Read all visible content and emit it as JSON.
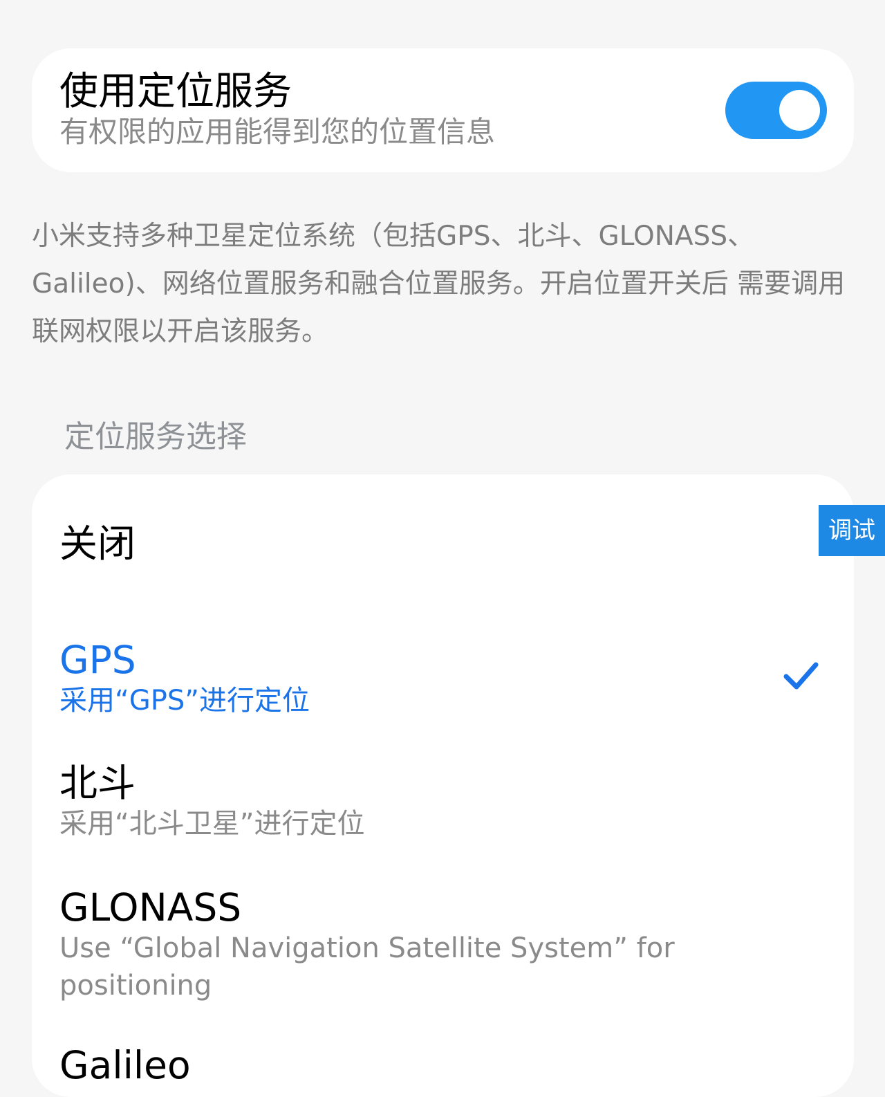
{
  "location_toggle": {
    "title": "使用定位服务",
    "subtitle": "有权限的应用能得到您的位置信息",
    "enabled": true,
    "accent_color": "#2196f3"
  },
  "description": "小米支持多种卫星定位系统（包括GPS、北斗、GLONASS、Galileo)、网络位置服务和融合位置服务。开启位置开关后 需要调用联网权限以开启该服务。",
  "section_header": "定位服务选择",
  "options": [
    {
      "title": "关闭",
      "subtitle": "",
      "selected": false
    },
    {
      "title": "GPS",
      "subtitle": "采用“GPS”进行定位",
      "selected": true
    },
    {
      "title": "北斗",
      "subtitle": "采用“北斗卫星”进行定位",
      "selected": false
    },
    {
      "title": "GLONASS",
      "subtitle": "Use “Global Navigation Satellite System” for positioning",
      "selected": false
    },
    {
      "title": "Galileo",
      "subtitle": "",
      "selected": false
    }
  ],
  "selected_icon": "checkmark-icon",
  "selected_color": "#1a73e8",
  "debug_tab": {
    "label": "调试"
  }
}
